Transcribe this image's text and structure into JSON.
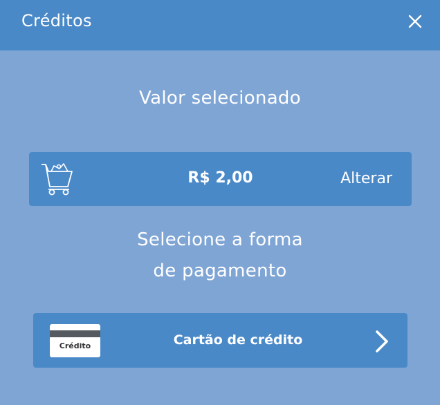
{
  "header": {
    "title": "Créditos",
    "close_icon": "close-icon"
  },
  "selected_value": {
    "title": "Valor selecionado",
    "amount": "R$ 2,00",
    "change_label": "Alterar",
    "icon": "shopping-cart-icon"
  },
  "payment": {
    "title_line1": "Selecione a forma",
    "title_line2": "de pagamento",
    "option": {
      "label": "Cartão de crédito",
      "card_text": "Crédito",
      "icon": "credit-card-icon",
      "arrow_icon": "chevron-right-icon"
    }
  },
  "colors": {
    "background": "#7fa5d5",
    "accent": "#4a89c8",
    "text": "#ffffff"
  }
}
